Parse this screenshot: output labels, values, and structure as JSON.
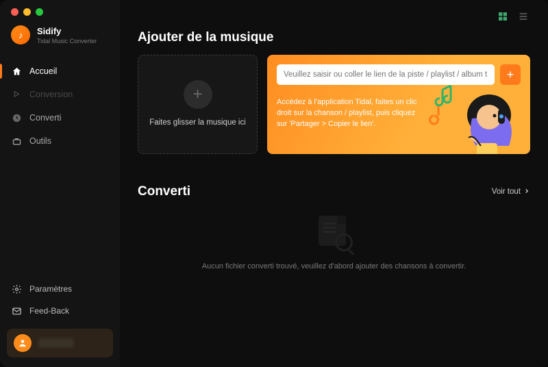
{
  "brand": {
    "title": "Sidify",
    "subtitle": "Tidal Music Converter"
  },
  "nav": {
    "home": "Accueil",
    "conversion": "Conversion",
    "converted": "Converti",
    "tools": "Outils"
  },
  "bottom": {
    "settings": "Paramètres",
    "feedback": "Feed-Back"
  },
  "section": {
    "add_title": "Ajouter de la musique",
    "dropzone": "Faites glisser la musique ici",
    "url_placeholder": "Veuillez saisir ou coller le lien de la piste / playlist / album tidal ici.",
    "hero_hint": "Accédez à l'application Tidal, faites un clic droit sur la chanson / playlist, puis cliquez sur 'Partager > Copier le lien'.",
    "converted_title": "Converti",
    "view_all": "Voir tout",
    "empty": "Aucun fichier converti trouvé, veuillez d'abord ajouter des chansons à convertir."
  },
  "colors": {
    "accent": "#ff7a1a"
  }
}
